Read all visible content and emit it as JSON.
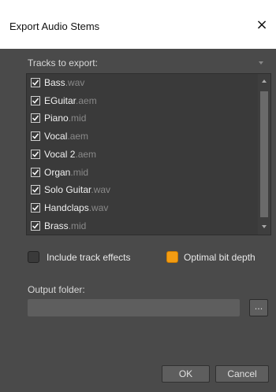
{
  "window": {
    "title": "Export Audio Stems",
    "close_glyph": "×"
  },
  "tracks_section": {
    "label": "Tracks to export:",
    "items": [
      {
        "name": "Bass",
        "ext": ".wav",
        "checked": true
      },
      {
        "name": "EGuitar",
        "ext": ".aem",
        "checked": true
      },
      {
        "name": "Piano",
        "ext": ".mid",
        "checked": true
      },
      {
        "name": "Vocal",
        "ext": ".aem",
        "checked": true
      },
      {
        "name": "Vocal 2",
        "ext": ".aem",
        "checked": true
      },
      {
        "name": "Organ",
        "ext": ".mid",
        "checked": true
      },
      {
        "name": "Solo Guitar",
        "ext": ".wav",
        "checked": true
      },
      {
        "name": "Handclaps",
        "ext": ".wav",
        "checked": true
      },
      {
        "name": "Brass",
        "ext": ".mid",
        "checked": true
      }
    ]
  },
  "options": {
    "include_effects": {
      "label": "Include track effects",
      "checked": false
    },
    "optimal_bit_depth": {
      "label": "Optimal bit depth",
      "checked": true
    }
  },
  "output": {
    "label": "Output folder:",
    "value": "",
    "browse_label": "..."
  },
  "buttons": {
    "ok": "OK",
    "cancel": "Cancel"
  },
  "colors": {
    "accent": "#f39c12",
    "background": "#4a4a4a",
    "list_bg": "#3a3a3a"
  }
}
